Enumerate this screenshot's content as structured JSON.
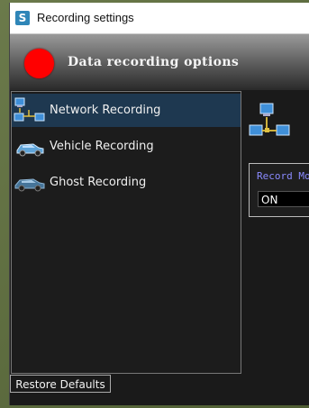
{
  "window": {
    "title": "Recording settings",
    "app_icon_glyph": "S",
    "app_icon": "settings-app-icon"
  },
  "header": {
    "title": "Data recording options",
    "indicator_color": "#ff0000",
    "indicator_icon": "record-dot-icon"
  },
  "sidebar": {
    "items": [
      {
        "label": "Network Recording",
        "icon": "network-icon",
        "selected": true
      },
      {
        "label": "Vehicle Recording",
        "icon": "car-icon",
        "selected": false
      },
      {
        "label": "Ghost Recording",
        "icon": "ghost-car-icon",
        "selected": false
      }
    ]
  },
  "panel": {
    "icon": "network-icon",
    "record_mode_label": "Record Mode",
    "record_mode_value": "ON"
  },
  "footer": {
    "restore_defaults": "Restore Defaults"
  },
  "colors": {
    "selection": "#1e3850",
    "label_accent": "#8a8aff",
    "header_gradient_top": "#9a9a9a",
    "header_gradient_bottom": "#2a2a2a"
  }
}
